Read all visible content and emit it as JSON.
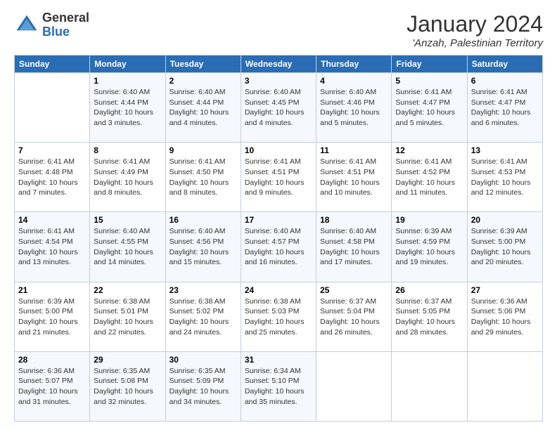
{
  "header": {
    "logo_general": "General",
    "logo_blue": "Blue",
    "month_title": "January 2024",
    "location": "'Anzah, Palestinian Territory"
  },
  "calendar": {
    "days_of_week": [
      "Sunday",
      "Monday",
      "Tuesday",
      "Wednesday",
      "Thursday",
      "Friday",
      "Saturday"
    ],
    "weeks": [
      [
        {
          "day": "",
          "info": ""
        },
        {
          "day": "1",
          "info": "Sunrise: 6:40 AM\nSunset: 4:44 PM\nDaylight: 10 hours\nand 3 minutes."
        },
        {
          "day": "2",
          "info": "Sunrise: 6:40 AM\nSunset: 4:44 PM\nDaylight: 10 hours\nand 4 minutes."
        },
        {
          "day": "3",
          "info": "Sunrise: 6:40 AM\nSunset: 4:45 PM\nDaylight: 10 hours\nand 4 minutes."
        },
        {
          "day": "4",
          "info": "Sunrise: 6:40 AM\nSunset: 4:46 PM\nDaylight: 10 hours\nand 5 minutes."
        },
        {
          "day": "5",
          "info": "Sunrise: 6:41 AM\nSunset: 4:47 PM\nDaylight: 10 hours\nand 5 minutes."
        },
        {
          "day": "6",
          "info": "Sunrise: 6:41 AM\nSunset: 4:47 PM\nDaylight: 10 hours\nand 6 minutes."
        }
      ],
      [
        {
          "day": "7",
          "info": "Sunrise: 6:41 AM\nSunset: 4:48 PM\nDaylight: 10 hours\nand 7 minutes."
        },
        {
          "day": "8",
          "info": "Sunrise: 6:41 AM\nSunset: 4:49 PM\nDaylight: 10 hours\nand 8 minutes."
        },
        {
          "day": "9",
          "info": "Sunrise: 6:41 AM\nSunset: 4:50 PM\nDaylight: 10 hours\nand 8 minutes."
        },
        {
          "day": "10",
          "info": "Sunrise: 6:41 AM\nSunset: 4:51 PM\nDaylight: 10 hours\nand 9 minutes."
        },
        {
          "day": "11",
          "info": "Sunrise: 6:41 AM\nSunset: 4:51 PM\nDaylight: 10 hours\nand 10 minutes."
        },
        {
          "day": "12",
          "info": "Sunrise: 6:41 AM\nSunset: 4:52 PM\nDaylight: 10 hours\nand 11 minutes."
        },
        {
          "day": "13",
          "info": "Sunrise: 6:41 AM\nSunset: 4:53 PM\nDaylight: 10 hours\nand 12 minutes."
        }
      ],
      [
        {
          "day": "14",
          "info": "Sunrise: 6:41 AM\nSunset: 4:54 PM\nDaylight: 10 hours\nand 13 minutes."
        },
        {
          "day": "15",
          "info": "Sunrise: 6:40 AM\nSunset: 4:55 PM\nDaylight: 10 hours\nand 14 minutes."
        },
        {
          "day": "16",
          "info": "Sunrise: 6:40 AM\nSunset: 4:56 PM\nDaylight: 10 hours\nand 15 minutes."
        },
        {
          "day": "17",
          "info": "Sunrise: 6:40 AM\nSunset: 4:57 PM\nDaylight: 10 hours\nand 16 minutes."
        },
        {
          "day": "18",
          "info": "Sunrise: 6:40 AM\nSunset: 4:58 PM\nDaylight: 10 hours\nand 17 minutes."
        },
        {
          "day": "19",
          "info": "Sunrise: 6:39 AM\nSunset: 4:59 PM\nDaylight: 10 hours\nand 19 minutes."
        },
        {
          "day": "20",
          "info": "Sunrise: 6:39 AM\nSunset: 5:00 PM\nDaylight: 10 hours\nand 20 minutes."
        }
      ],
      [
        {
          "day": "21",
          "info": "Sunrise: 6:39 AM\nSunset: 5:00 PM\nDaylight: 10 hours\nand 21 minutes."
        },
        {
          "day": "22",
          "info": "Sunrise: 6:38 AM\nSunset: 5:01 PM\nDaylight: 10 hours\nand 22 minutes."
        },
        {
          "day": "23",
          "info": "Sunrise: 6:38 AM\nSunset: 5:02 PM\nDaylight: 10 hours\nand 24 minutes."
        },
        {
          "day": "24",
          "info": "Sunrise: 6:38 AM\nSunset: 5:03 PM\nDaylight: 10 hours\nand 25 minutes."
        },
        {
          "day": "25",
          "info": "Sunrise: 6:37 AM\nSunset: 5:04 PM\nDaylight: 10 hours\nand 26 minutes."
        },
        {
          "day": "26",
          "info": "Sunrise: 6:37 AM\nSunset: 5:05 PM\nDaylight: 10 hours\nand 28 minutes."
        },
        {
          "day": "27",
          "info": "Sunrise: 6:36 AM\nSunset: 5:06 PM\nDaylight: 10 hours\nand 29 minutes."
        }
      ],
      [
        {
          "day": "28",
          "info": "Sunrise: 6:36 AM\nSunset: 5:07 PM\nDaylight: 10 hours\nand 31 minutes."
        },
        {
          "day": "29",
          "info": "Sunrise: 6:35 AM\nSunset: 5:08 PM\nDaylight: 10 hours\nand 32 minutes."
        },
        {
          "day": "30",
          "info": "Sunrise: 6:35 AM\nSunset: 5:09 PM\nDaylight: 10 hours\nand 34 minutes."
        },
        {
          "day": "31",
          "info": "Sunrise: 6:34 AM\nSunset: 5:10 PM\nDaylight: 10 hours\nand 35 minutes."
        },
        {
          "day": "",
          "info": ""
        },
        {
          "day": "",
          "info": ""
        },
        {
          "day": "",
          "info": ""
        }
      ]
    ]
  }
}
